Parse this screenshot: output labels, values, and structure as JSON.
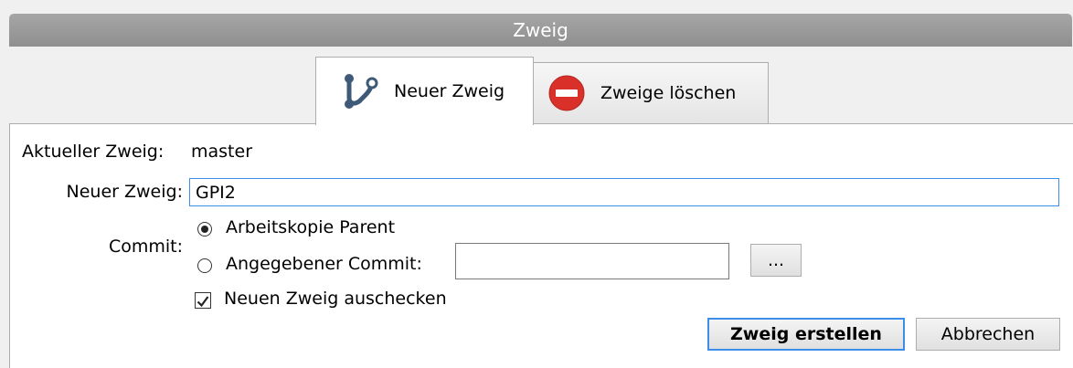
{
  "window": {
    "title": "Zweig"
  },
  "tabs": [
    {
      "label": "Neuer Zweig",
      "icon": "branch-icon"
    },
    {
      "label": "Zweige löschen",
      "icon": "delete-icon"
    }
  ],
  "form": {
    "current_branch_label": "Aktueller Zweig:",
    "current_branch_value": "master",
    "new_branch_label": "Neuer Zweig:",
    "new_branch_value": "GPI2",
    "commit_label": "Commit:",
    "radio_working_copy": "Arbeitskopie Parent",
    "radio_specified": "Angegebener Commit:",
    "specified_commit_value": "",
    "browse_label": "...",
    "checkout_label": "Neuen Zweig auschecken"
  },
  "buttons": {
    "create": "Zweig erstellen",
    "cancel": "Abbrechen"
  },
  "colors": {
    "focus": "#3d8ee8",
    "delete_icon": "#d9312a",
    "branch_icon": "#3e5a78"
  }
}
